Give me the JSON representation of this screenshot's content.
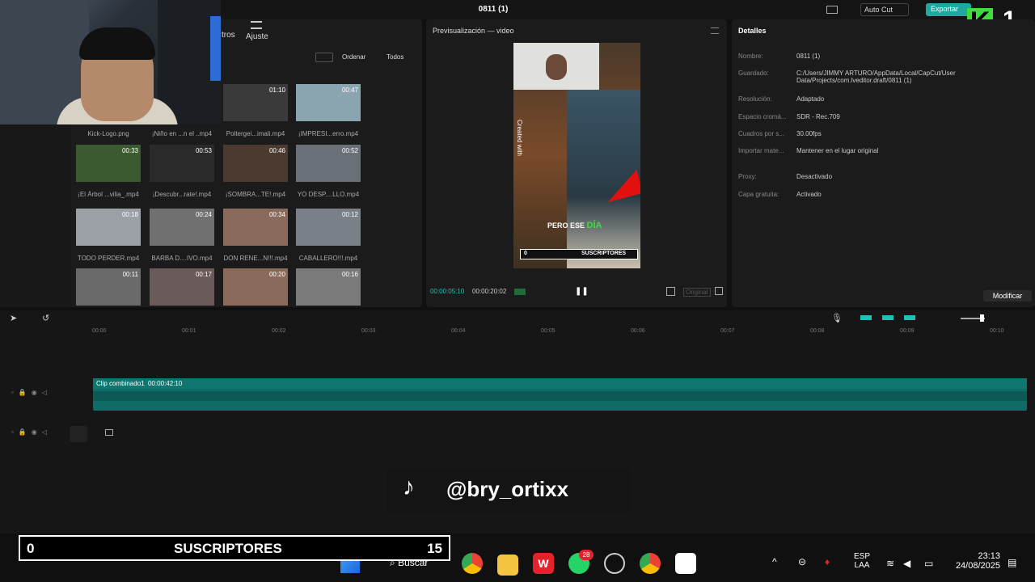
{
  "window": {
    "title": "0811 (1)",
    "autocut_label": "Auto Cut",
    "export_label": "Exportar",
    "overlay_logo": "K",
    "overlay_number": "1"
  },
  "media": {
    "toolbar": [
      "tros",
      "Ajuste"
    ],
    "sort_label": "Ordenar",
    "filter_label": "Todos",
    "items": [
      {
        "label": "Kick-Logo.png",
        "duration": ""
      },
      {
        "label": "¡Niño en ...n el ..mp4",
        "duration": ""
      },
      {
        "label": "Poltergei...imali.mp4",
        "duration": "01:10"
      },
      {
        "label": "¡IMPRESI...erro.mp4",
        "duration": "00:47"
      },
      {
        "label": "¡El Árbol ...vilia_.mp4",
        "duration": "00:33"
      },
      {
        "label": "¡Descubr...rate!.mp4",
        "duration": "00:53"
      },
      {
        "label": "¡SOMBRA...TE!.mp4",
        "duration": "00:46"
      },
      {
        "label": "YO DESP....LLO.mp4",
        "duration": "00:52"
      },
      {
        "label": "TODO PERDER.mp4",
        "duration": "00:18"
      },
      {
        "label": "BARBA D....IVO.mp4",
        "duration": "00:24"
      },
      {
        "label": "DON RENE...N!!!.mp4",
        "duration": "00:34"
      },
      {
        "label": "CABALLERO!!!.mp4",
        "duration": "00:12"
      },
      {
        "label": "",
        "duration": "00:11"
      },
      {
        "label": "",
        "duration": "00:17"
      },
      {
        "label": "",
        "duration": "00:20"
      },
      {
        "label": "",
        "duration": "00:16"
      }
    ]
  },
  "preview": {
    "header": "Previsualización — video",
    "caption_word1": "PERO ESE",
    "caption_word2": "DÍA",
    "mini_sub_count": "0",
    "mini_sub_label": "SUSCRIPTORES",
    "side_text": "Created with",
    "current_time": "00:00:05:10",
    "total_time": "00:00:20:02",
    "original_label": "Original"
  },
  "details": {
    "header": "Detalles",
    "rows": [
      {
        "label": "Nombre:",
        "value": "0811 (1)"
      },
      {
        "label": "Guardado:",
        "value": "C:/Users/JIMMY ARTURO/AppData/Local/CapCut/User Data/Projects/com.lveditor.draft/0811 (1)"
      },
      {
        "label": "Resolución:",
        "value": "Adaptado"
      },
      {
        "label": "Espacio cromá...",
        "value": "SDR - Rec.709"
      },
      {
        "label": "Cuadros por s...",
        "value": "30.00fps"
      },
      {
        "label": "Importar mate...",
        "value": "Mantener en el lugar original"
      },
      {
        "label": "Proxy:",
        "value": "Desactivado"
      },
      {
        "label": "Capa gratuita:",
        "value": "Activado"
      }
    ],
    "modify_label": "Modificar"
  },
  "timeline": {
    "ticks": [
      "00:00",
      "00:01",
      "00:02",
      "00:03",
      "00:04",
      "00:05",
      "00:06",
      "00:07",
      "00:08",
      "00:09",
      "00:10"
    ],
    "clip_label": "Clip combinado1",
    "clip_duration": "00:00:42:10"
  },
  "overlay": {
    "tiktok_handle": "@bry_ortixx",
    "subs_current": "0",
    "subs_label": "SUSCRIPTORES",
    "subs_goal": "15"
  },
  "taskbar": {
    "search_label": "Buscar",
    "whatsapp_badge": "28",
    "lang1": "ESP",
    "lang2": "LAA",
    "time": "23:13",
    "date": "24/08/2025"
  }
}
